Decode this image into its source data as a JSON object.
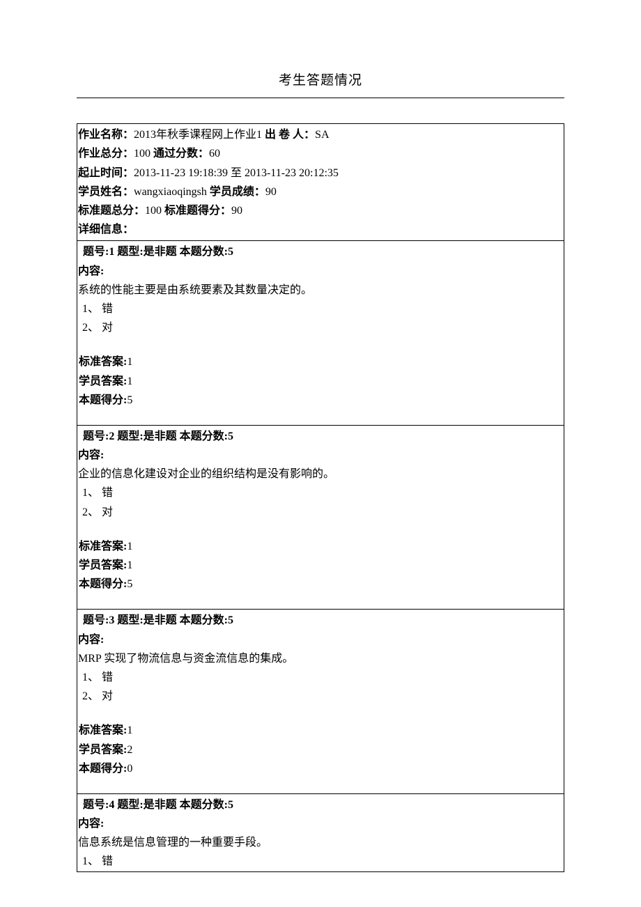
{
  "title": "考生答题情况",
  "header": {
    "assignment_label": "作业名称：",
    "assignment_name": "2013年秋季课程网上作业1",
    "issuer_label": " 出 卷 人：",
    "issuer": "SA",
    "total_label": "作业总分：",
    "total": "100",
    "pass_label": " 通过分数：",
    "pass": "60",
    "time_label": "起止时间：",
    "time_range": "2013-11-23 19:18:39 至 2013-11-23 20:12:35",
    "student_label": "学员姓名：",
    "student_name": "wangxiaoqingsh",
    "score_label": " 学员成绩：",
    "score": "90",
    "std_total_label": "标准题总分：",
    "std_total": "100",
    "std_score_label": " 标准题得分：",
    "std_score": "90",
    "detail_label": "详细信息："
  },
  "labels": {
    "content": "内容:",
    "std_answer": "标准答案:",
    "stu_answer": "学员答案:",
    "obtained": "本题得分:"
  },
  "questions": [
    {
      "header": "题号:1 题型:是非题 本题分数:5",
      "content": "系统的性能主要是由系统要素及其数量决定的。",
      "options": [
        "1、 错",
        "2、 对"
      ],
      "std_answer": "1",
      "stu_answer": "1",
      "obtained": "5"
    },
    {
      "header": "题号:2 题型:是非题 本题分数:5",
      "content": "企业的信息化建设对企业的组织结构是没有影响的。",
      "options": [
        "1、 错",
        "2、 对"
      ],
      "std_answer": "1",
      "stu_answer": "1",
      "obtained": "5"
    },
    {
      "header": "题号:3 题型:是非题 本题分数:5",
      "content": "MRP 实现了物流信息与资金流信息的集成。",
      "options": [
        "1、 错",
        "2、 对"
      ],
      "std_answer": "1",
      "stu_answer": "2",
      "obtained": "0"
    },
    {
      "header": "题号:4 题型:是非题 本题分数:5",
      "content": "信息系统是信息管理的一种重要手段。",
      "options": [
        "1、 错"
      ],
      "std_answer": "",
      "stu_answer": "",
      "obtained": ""
    }
  ]
}
